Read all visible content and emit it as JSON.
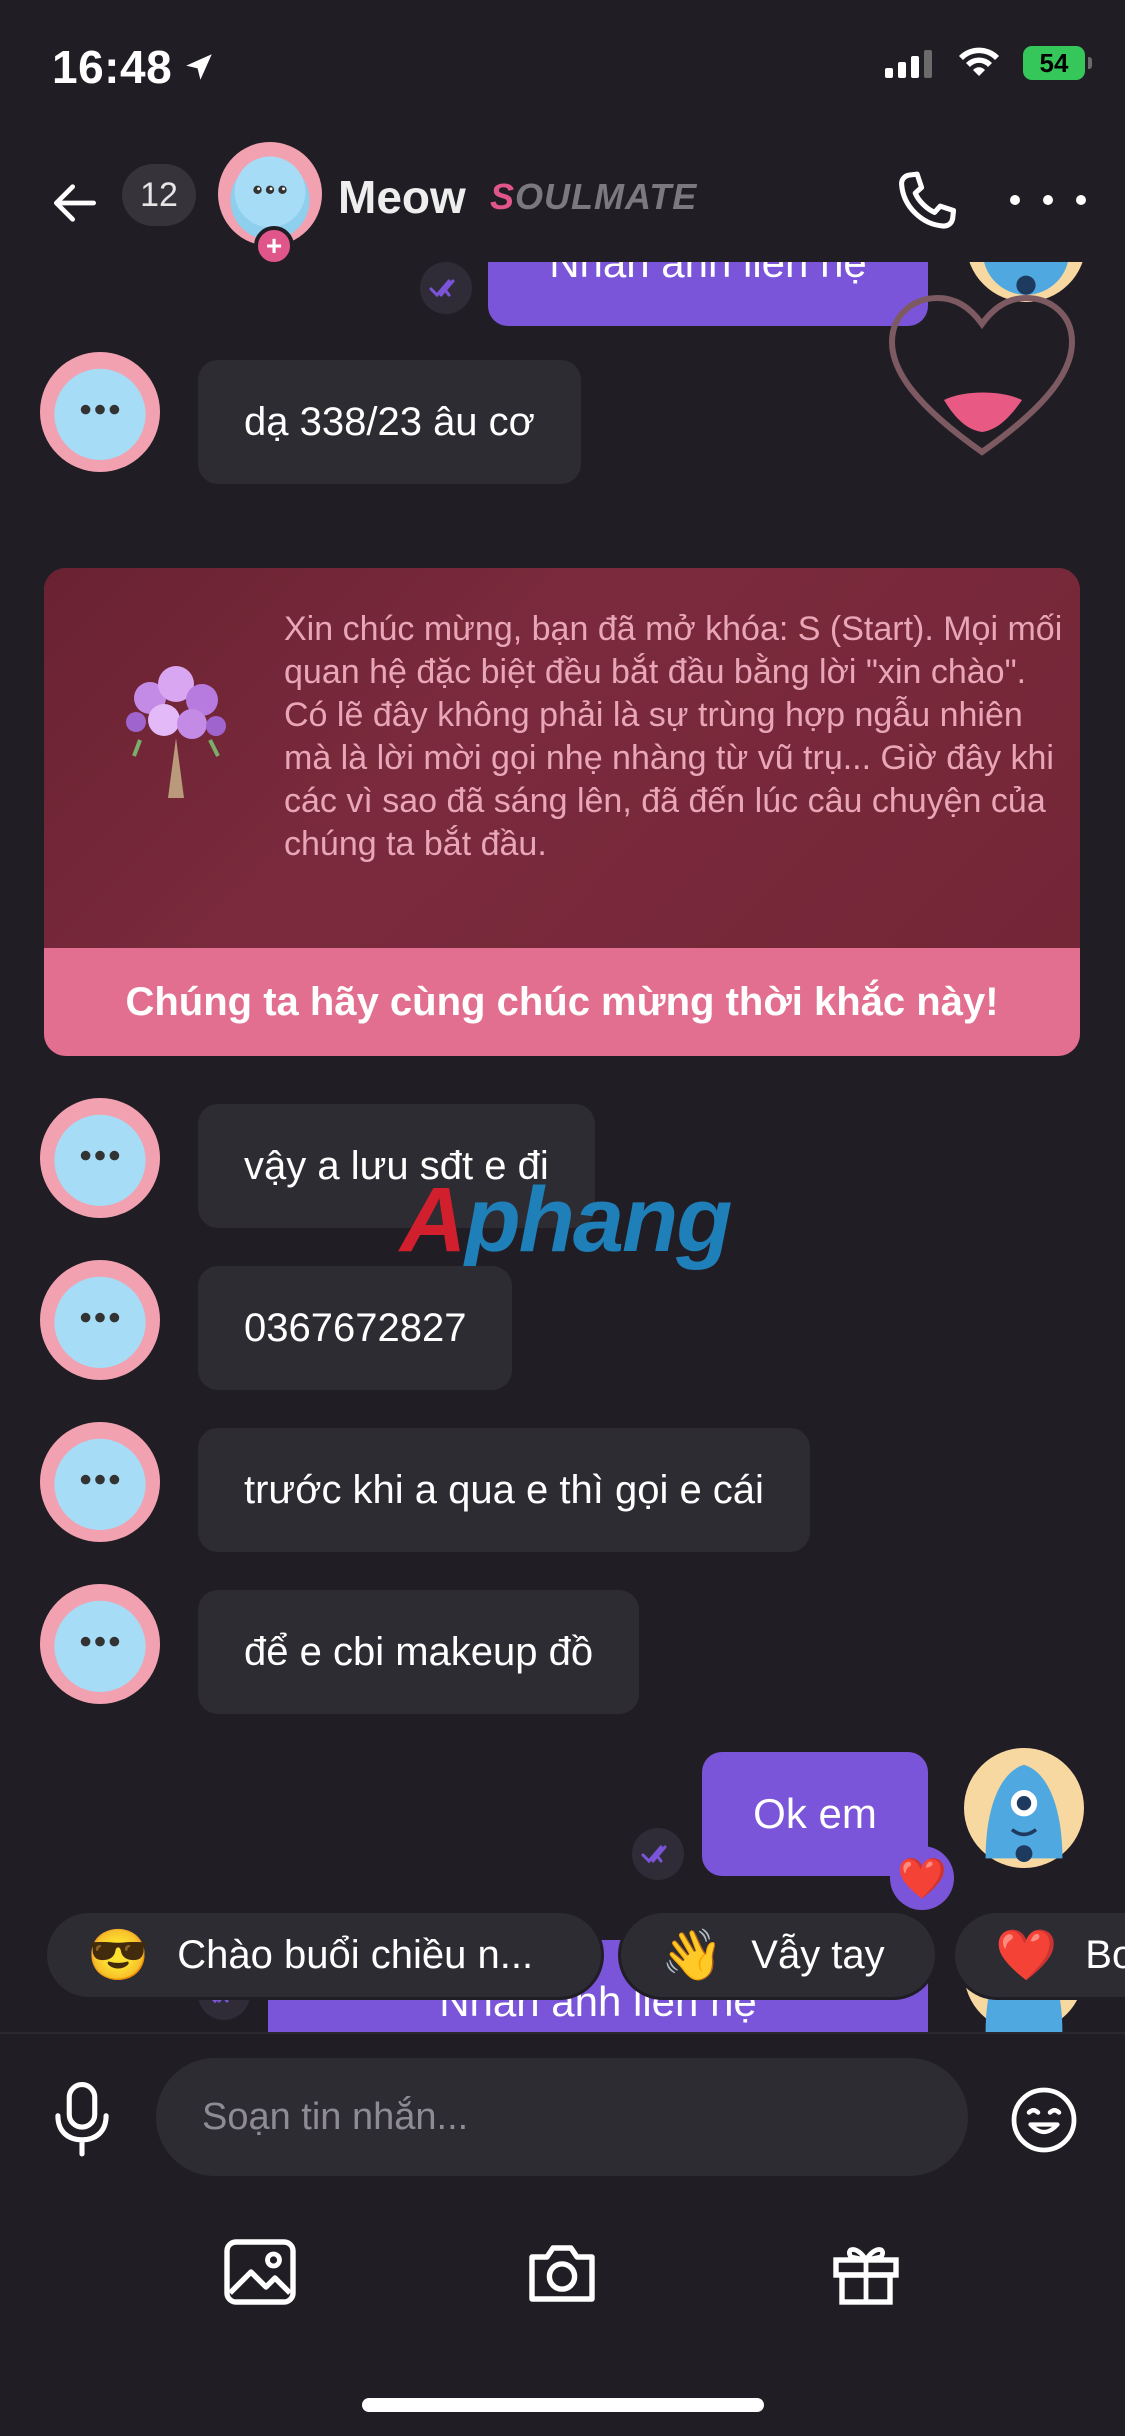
{
  "status_bar": {
    "time": "16:48",
    "battery": "54"
  },
  "header": {
    "unread_count": "12",
    "contact_name": "Meow",
    "badge_prefix": "S",
    "badge_rest": "OULMATE"
  },
  "messages": {
    "top_partial_out": "Nhắn anh liên hệ",
    "in_1": "dạ 338/23 âu cơ",
    "in_2": "vậy a lưu sđt e đi",
    "in_3": "0367672827",
    "in_4": "trước khi a qua e thì gọi e cái",
    "in_5": "để e cbi makeup đồ",
    "out_1": "Ok em",
    "bottom_partial_out": "Nhắn anh liên hệ"
  },
  "celebration": {
    "text": "Xin chúc mừng, bạn đã mở khóa: S (Start). Mọi mối quan hệ đặc biệt đều bắt đầu bằng lời \"xin chào\". Có lẽ đây không phải là sự trùng hợp ngẫu nhiên mà là lời mời gọi nhẹ nhàng từ vũ trụ... Giờ đây khi các vì sao đã sáng lên, đã đến lúc câu chuyện của chúng ta bắt đầu.",
    "cta": "Chúng ta hãy cùng chúc mừng thời khắc này!"
  },
  "watermark": {
    "part1": "A",
    "part2": "phang"
  },
  "quick_replies": [
    {
      "emoji": "😎",
      "label": "Chào buổi chiều n..."
    },
    {
      "emoji": "👋",
      "label": "Vẫy tay"
    },
    {
      "emoji": "❤️",
      "label": "Bo"
    }
  ],
  "composer": {
    "placeholder": "Soạn tin nhắn..."
  },
  "colors": {
    "background": "#201e24",
    "bubble_in": "#2e2c33",
    "bubble_out": "#7b55d9",
    "accent_pink": "#e0568a",
    "card_bg": "#7a2a3c",
    "card_cta": "#e26f8f"
  },
  "icons": {
    "back": "back-arrow-icon",
    "call": "phone-icon",
    "more": "more-dots-icon",
    "mic": "microphone-icon",
    "emoji": "emoji-icon",
    "gallery": "image-icon",
    "camera": "camera-icon",
    "gift": "gift-icon"
  }
}
